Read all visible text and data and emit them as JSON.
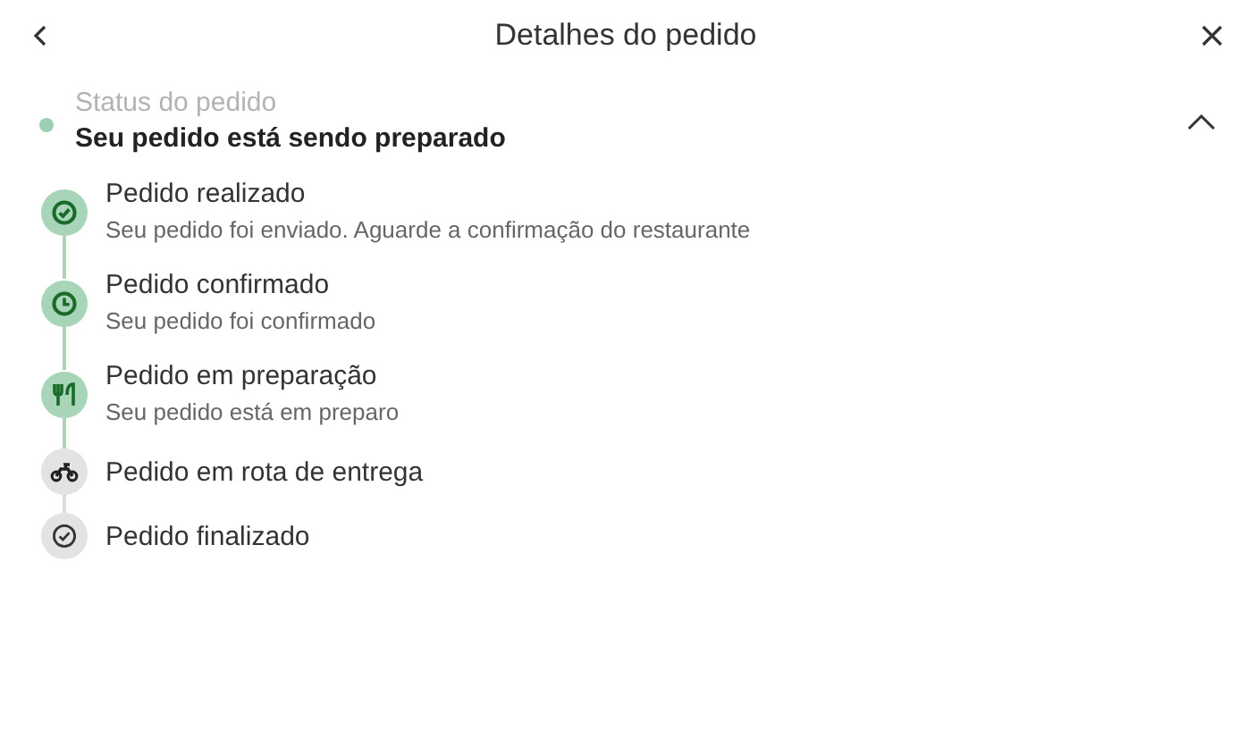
{
  "header": {
    "title": "Detalhes do pedido"
  },
  "status": {
    "label": "Status do pedido",
    "value": "Seu pedido está sendo preparado",
    "expanded": true
  },
  "steps": [
    {
      "kind": "check",
      "title": "Pedido realizado",
      "description": "Seu pedido foi enviado. Aguarde a confirmação do restaurante",
      "done": true
    },
    {
      "kind": "clock",
      "title": "Pedido confirmado",
      "description": "Seu pedido foi confirmado",
      "done": true
    },
    {
      "kind": "utensils",
      "title": "Pedido em preparação",
      "description": "Seu pedido está em preparo",
      "done": true
    },
    {
      "kind": "motorbike",
      "title": "Pedido em rota de entrega",
      "done": false
    },
    {
      "kind": "check",
      "title": "Pedido finalizado",
      "done": false
    }
  ]
}
